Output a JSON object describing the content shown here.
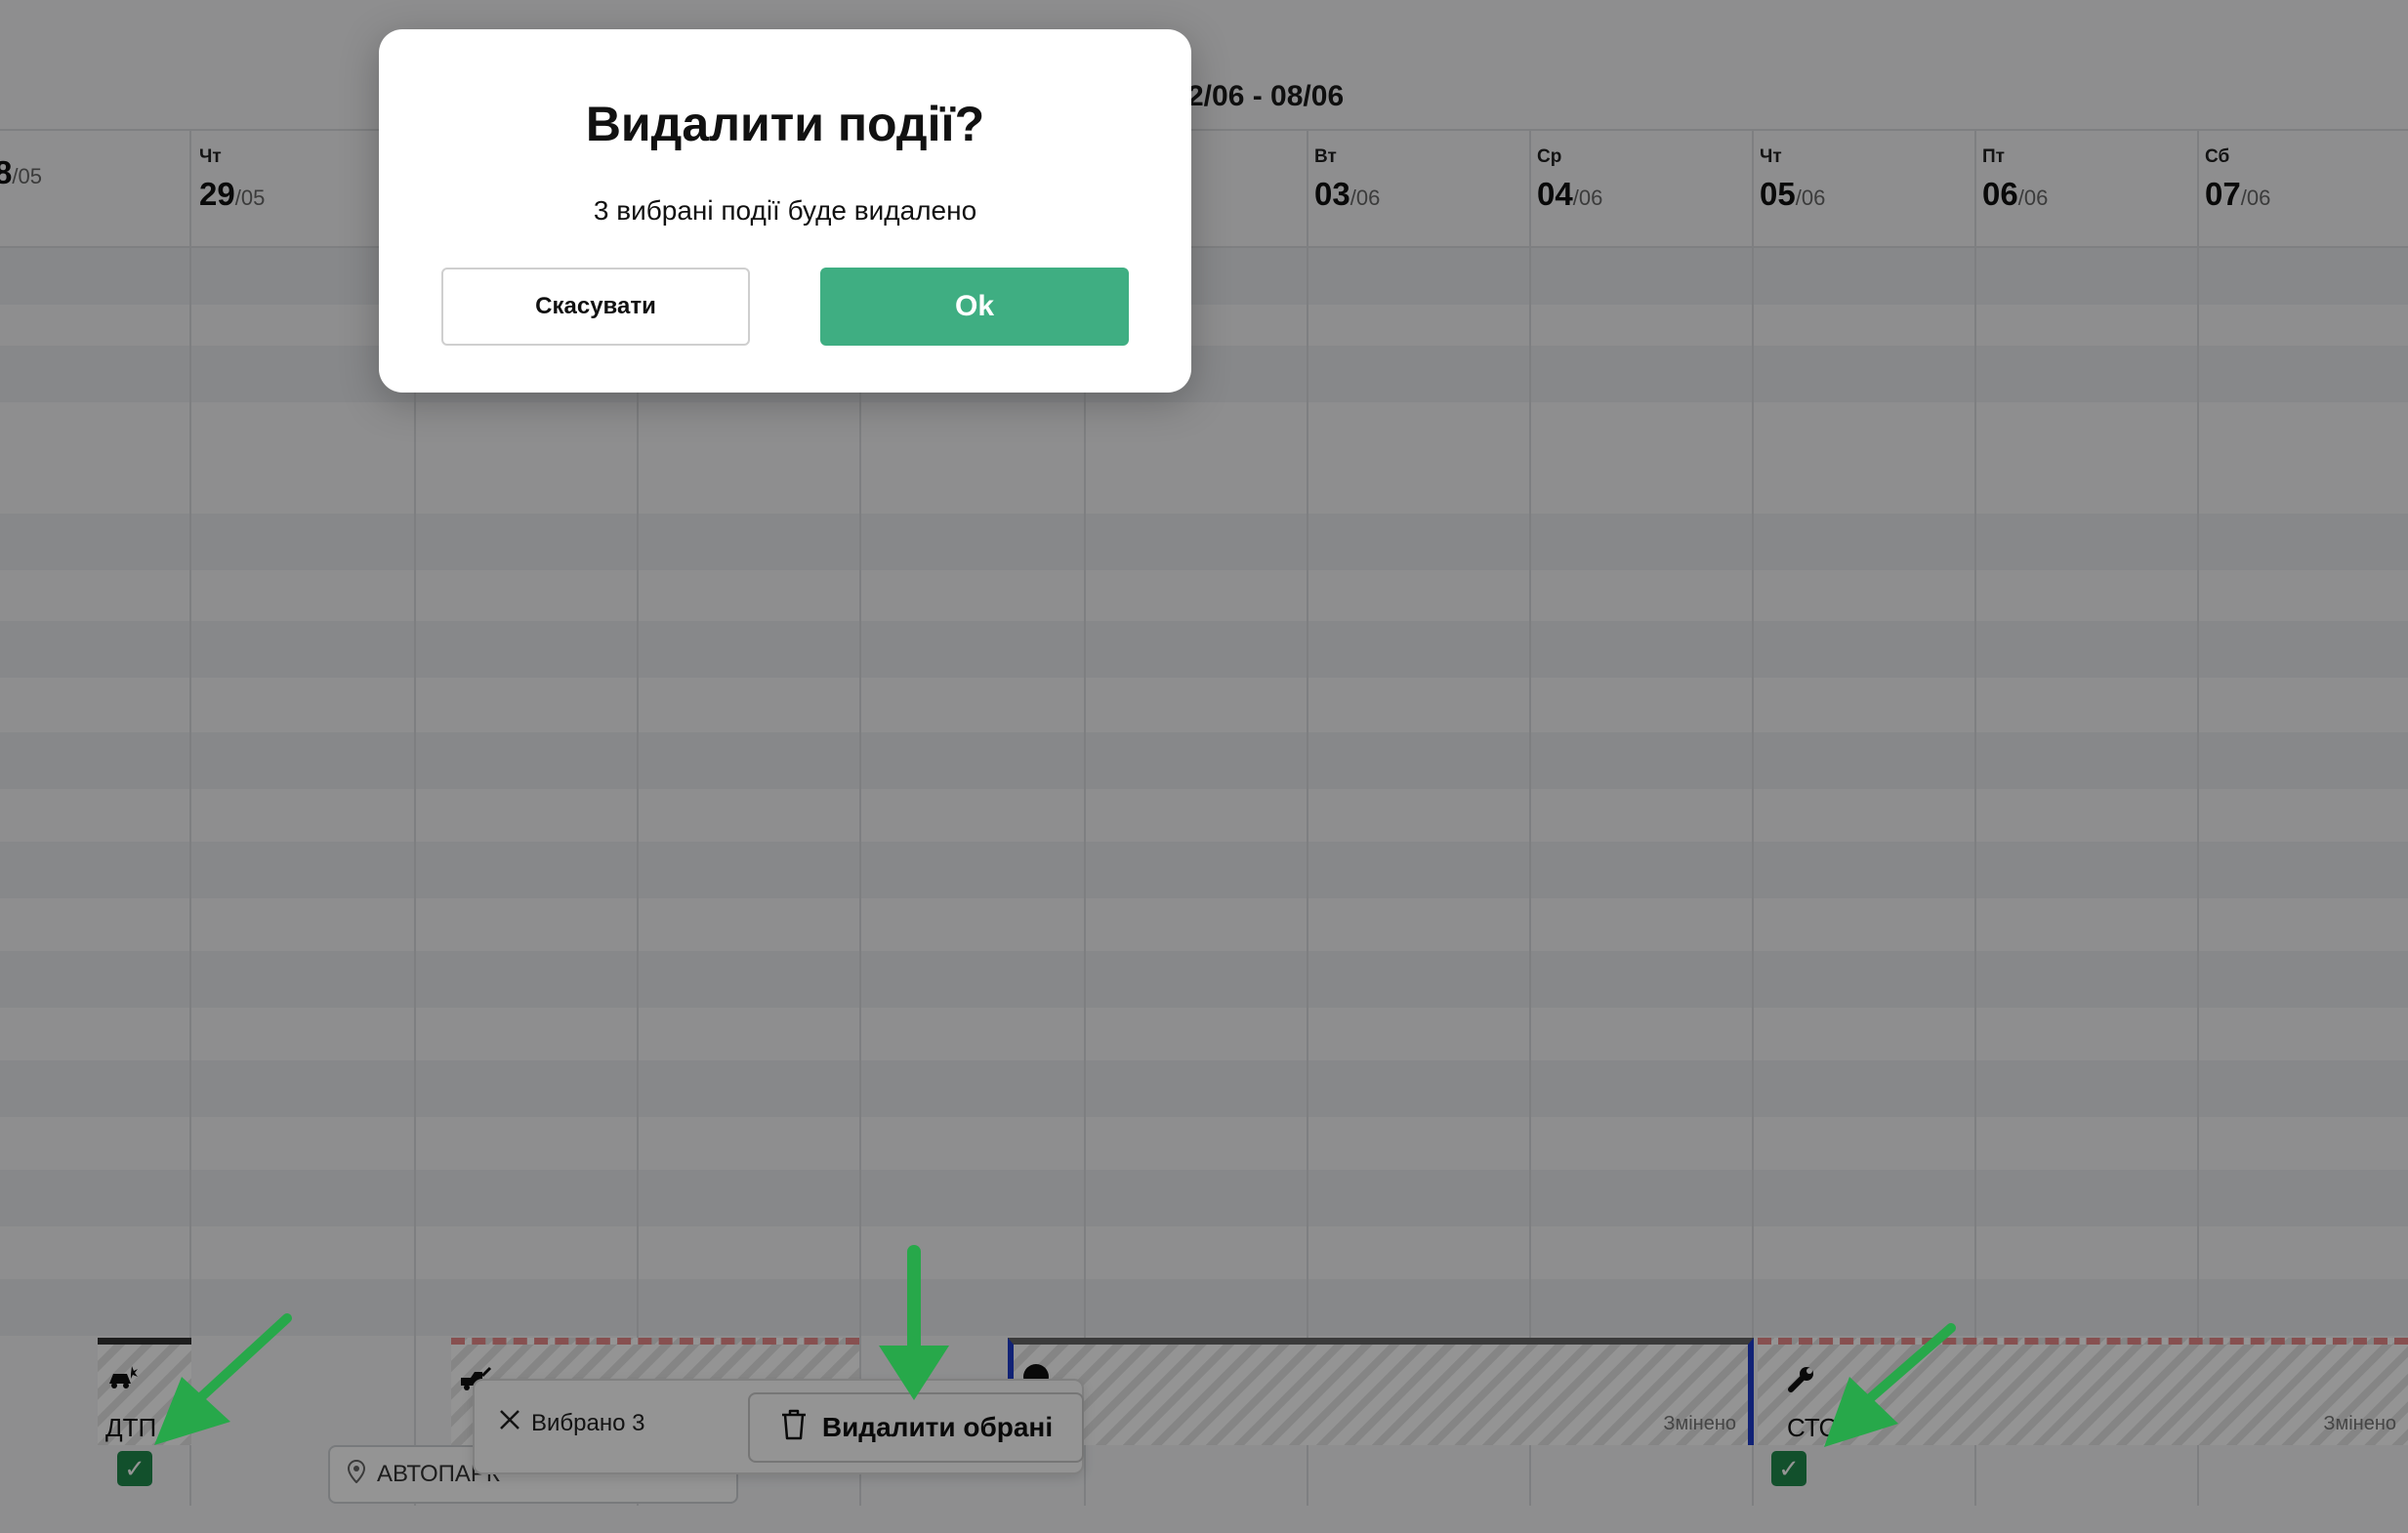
{
  "calendar": {
    "week_range": "2/06 - 08/06",
    "days": [
      {
        "dow": "",
        "day": "8",
        "month": "/05"
      },
      {
        "dow": "Чт",
        "day": "29",
        "month": "/05"
      },
      {
        "dow": "Вт",
        "day": "03",
        "month": "/06"
      },
      {
        "dow": "Ср",
        "day": "04",
        "month": "/06"
      },
      {
        "dow": "Чт",
        "day": "05",
        "month": "/06"
      },
      {
        "dow": "Пт",
        "day": "06",
        "month": "/06"
      },
      {
        "dow": "Сб",
        "day": "07",
        "month": "/06"
      }
    ]
  },
  "events": [
    {
      "label": "ДТП",
      "icon": "car-crash-icon",
      "checked": true
    },
    {
      "label": "",
      "icon": "tow-truck-icon",
      "checked": false
    },
    {
      "label": "",
      "icon": "user-icon",
      "checked": false,
      "edited": "Змінено"
    },
    {
      "label": "СТО",
      "icon": "wrench-icon",
      "checked": true,
      "edited": "Змінено"
    }
  ],
  "location_field": {
    "value": "АВТОПАРК",
    "icon": "location-pin-icon"
  },
  "selection_bar": {
    "selected_label": "Вибрано 3",
    "delete_label": "Видалити обрані"
  },
  "modal": {
    "title": "Видалити події?",
    "message": "3 вибрані події буде видалено",
    "cancel_label": "Скасувати",
    "ok_label": "Ok"
  },
  "colors": {
    "ok_button": "#3fae82",
    "checkbox": "#1f8a4c",
    "arrow": "#27a84a",
    "event_border_blue": "#1e3ccb"
  }
}
